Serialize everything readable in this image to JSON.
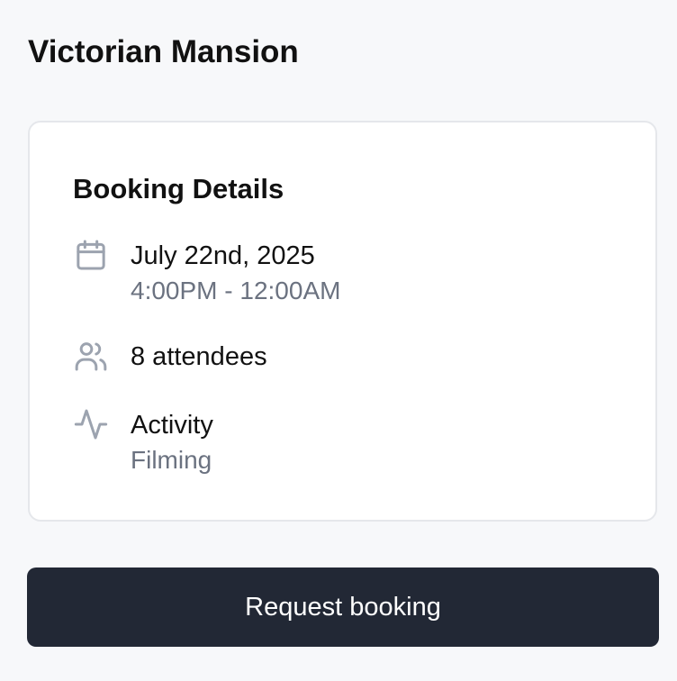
{
  "page": {
    "title": "Victorian Mansion"
  },
  "booking": {
    "heading": "Booking Details",
    "date": {
      "icon": "calendar-icon",
      "primary": "July 22nd, 2025",
      "secondary": "4:00PM - 12:00AM"
    },
    "attendees": {
      "icon": "users-icon",
      "primary": "8 attendees"
    },
    "activity": {
      "icon": "activity-icon",
      "primary": "Activity",
      "secondary": "Filming"
    }
  },
  "actions": {
    "request_label": "Request booking"
  },
  "colors": {
    "background": "#f7f8fa",
    "card": "#ffffff",
    "button": "#222835",
    "muted_text": "#6b7280",
    "icon": "#9ca3af"
  }
}
